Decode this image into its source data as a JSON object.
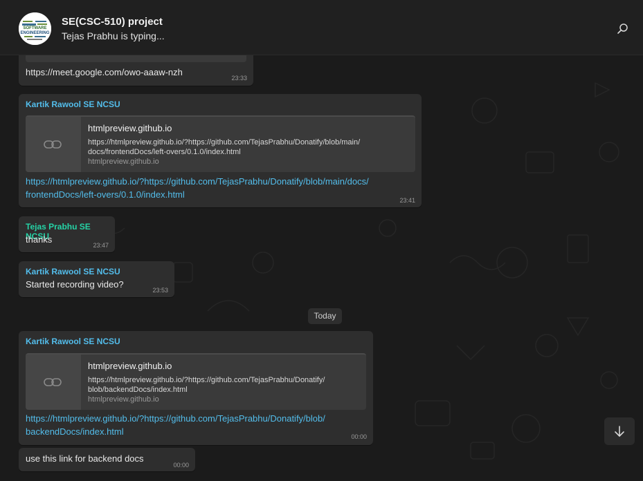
{
  "header": {
    "title": "SE(CSC-510) project",
    "status": "Tejas Prabhu is typing...",
    "avatar_text": "SOFTWARE ENGINEERING"
  },
  "messages": {
    "m0": {
      "link": "https://meet.google.com/owo-aaaw-nzh",
      "time": "23:33"
    },
    "m1": {
      "sender": "Kartik Rawool SE NCSU",
      "preview_title": "htmlpreview.github.io",
      "preview_desc_1": "https://htmlpreview.github.io/?https://github.com/TejasPrabhu/Donatify/blob/main/",
      "preview_desc_2": "docs/frontendDocs/left-overs/0.1.0/index.html",
      "preview_domain": "htmlpreview.github.io",
      "link_1": "https://htmlpreview.github.io/?https://github.com/TejasPrabhu/Donatify/blob/main/docs/",
      "link_2": "frontendDocs/left-overs/0.1.0/index.html",
      "time": "23:41"
    },
    "m2": {
      "sender": "Tejas Prabhu SE NCSU",
      "text": "thanks",
      "time": "23:47"
    },
    "m3": {
      "sender": "Kartik Rawool SE NCSU",
      "text": "Started recording video?",
      "time": "23:53"
    },
    "date_divider": "Today",
    "m4": {
      "sender": "Kartik Rawool SE NCSU",
      "preview_title": "htmlpreview.github.io",
      "preview_desc_1": "https://htmlpreview.github.io/?https://github.com/TejasPrabhu/Donatify/",
      "preview_desc_2": "blob/backendDocs/index.html",
      "preview_domain": "htmlpreview.github.io",
      "link_1": "https://htmlpreview.github.io/?https://github.com/TejasPrabhu/Donatify/blob/",
      "link_2": "backendDocs/index.html",
      "time": "00:00"
    },
    "m5": {
      "text": "use this link for backend docs",
      "time": "00:00"
    }
  },
  "colors": {
    "header_bg": "#202020",
    "chat_bg": "#1b1b1b",
    "bubble_bg": "#2e2e2e",
    "link": "#53bdeb",
    "sender_green": "#25d3a6"
  },
  "icons": {
    "search": "search-icon",
    "link": "link-icon",
    "scroll_down": "arrow-down-icon"
  }
}
